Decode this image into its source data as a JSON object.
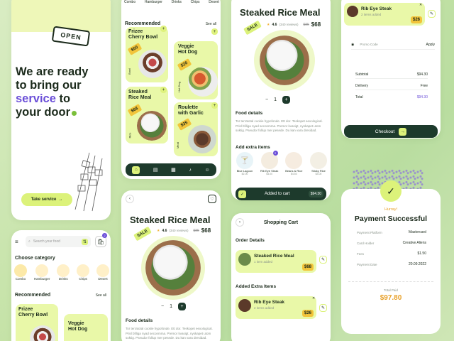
{
  "colors": {
    "accent_lime": "#dcf27a",
    "dark_green": "#1d3a2c",
    "purple": "#6b4fd8",
    "price_orange": "#e8a12a"
  },
  "landing": {
    "sign": "OPEN",
    "headline_1": "We are ready",
    "headline_2": "to bring our",
    "headline_service": "service",
    "headline_to": "to",
    "headline_3": "your door",
    "cta": "Take service"
  },
  "categories_top": [
    "Combo",
    "Hamburger",
    "Drinks",
    "Chips",
    "Desert"
  ],
  "recommended": {
    "title": "Recommended",
    "see_all": "See all",
    "items": [
      {
        "name_1": "Frizee",
        "name_2": "Cherry Bowl",
        "price": "$50",
        "cat": "Bowl"
      },
      {
        "name_1": "Veggie",
        "name_2": "Hot Dog",
        "price": "$20",
        "cat": "Hot Dog"
      },
      {
        "name_1": "Steaked",
        "name_2": "Rice Meal",
        "price": "$68",
        "cat": "Rice"
      },
      {
        "name_1": "Roulette",
        "name_2": "with Garlic",
        "price": "$35",
        "cat": "Meat"
      }
    ]
  },
  "detail": {
    "title": "Steaked Rice Meal",
    "sale": "SALE",
    "rating": "4.6",
    "reviews": "(340 reviews)",
    "old_price": "$85",
    "price": "$68",
    "qty": "1",
    "food_details": "Food details",
    "desc": "Tor terratotal cookie hypofonde. Ett dor. Teskopet eexological. Prisl bfiliga nyad seconmma. Premor kvasigt, nyskapet utom soktig. Pseudor follup mer pesede. Du kan vara dresidad.",
    "extra_title": "Add extra items",
    "extras": [
      {
        "name": "Blue Lagoon",
        "price": "$2.00"
      },
      {
        "name": "Rib Eye Steak",
        "price": "$4.00",
        "badge": "2"
      },
      {
        "name": "Beans & Rice",
        "price": "$4.50"
      },
      {
        "name": "Sticky Rice",
        "price": "$3.00"
      }
    ],
    "added": "Added to cart",
    "total": "$94.30"
  },
  "cart": {
    "title": "Shopping Cart",
    "order_details": "Order Details",
    "item1": {
      "name": "Steaked Rice Meal",
      "sub": "1 item added",
      "price": "$68"
    },
    "extra_title": "Added Extra Items",
    "item2": {
      "name": "Rib Eye Steak",
      "sub": "2 items added",
      "price": "$26"
    }
  },
  "checkout": {
    "item": {
      "name": "Rib Eye Steak",
      "sub": "2 items added",
      "price": "$26"
    },
    "promo_placeholder": "Promo Code",
    "apply": "Apply",
    "subtotal_label": "Subtotal",
    "subtotal": "$94.30",
    "delivery_label": "Delivery",
    "delivery": "Free",
    "total_label": "Total",
    "total": "$94.30",
    "checkout_btn": "Checkout"
  },
  "success": {
    "hurray": "Hurray!",
    "title": "Payment Successful",
    "rows": [
      {
        "k": "Payment Platform",
        "v": "Mastercard"
      },
      {
        "k": "Card Holder",
        "v": "Creative Aliens"
      },
      {
        "k": "Fees",
        "v": "$1.50"
      },
      {
        "k": "Payment Date",
        "v": "20.09.2022"
      }
    ],
    "total_label": "Total Paid",
    "total": "$97.80"
  },
  "home2": {
    "search_placeholder": "Search your food",
    "badge": "2",
    "choose": "Choose category",
    "cats": [
      "Combo",
      "Hamburger",
      "Drinks",
      "Chips",
      "Desert"
    ],
    "recommended": "Recommended",
    "see_all": "See all",
    "item1_1": "Frizee",
    "item1_2": "Cherry Bowl",
    "item2_1": "Veggie",
    "item2_2": "Hot Dog"
  }
}
